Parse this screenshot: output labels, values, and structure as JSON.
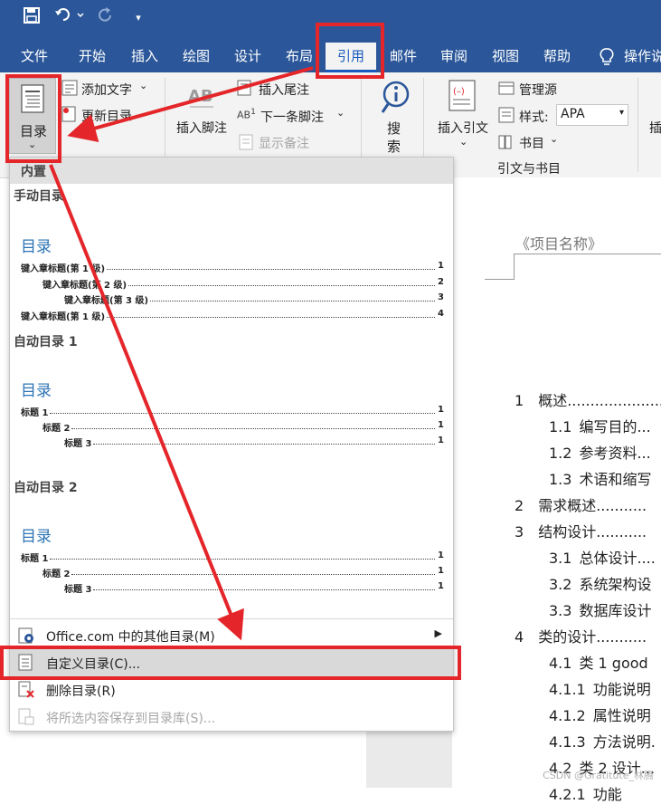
{
  "qat": {
    "save_icon": "save-icon",
    "undo_icon": "undo-icon",
    "redo_icon": "redo-icon",
    "customize_icon": "customize-icon"
  },
  "tabs": [
    "文件",
    "开始",
    "插入",
    "绘图",
    "设计",
    "布局",
    "引用",
    "邮件",
    "审阅",
    "视图",
    "帮助"
  ],
  "tell_me": "操作说",
  "ribbon": {
    "toc_button": "目录",
    "add_text": "添加文字",
    "update_toc": "更新目录",
    "insert_footnote": "插入脚注",
    "insert_endnote": "插入尾注",
    "next_footnote": "下一条脚注",
    "show_notes": "显示备注",
    "search_1": "搜",
    "search_2": "索",
    "insert_citation": "插入引文",
    "manage_sources": "管理源",
    "style_label": "样式:",
    "style_value": "APA",
    "bibliography": "书目",
    "group_citations": "引文与书目",
    "cut_label": "插"
  },
  "menu": {
    "section_builtin": "内置",
    "manual_title": "手动目录",
    "auto1_title": "自动目录 1",
    "auto2_title": "自动目录 2",
    "toc_heading": "目录",
    "manual_lines": [
      {
        "text": "键入章标题(第 1 级)",
        "num": "1"
      },
      {
        "text": "键入章标题(第 2 级)",
        "num": "2"
      },
      {
        "text": "键入章标题(第 3 级)",
        "num": "3"
      },
      {
        "text": "键入章标题(第 1 级)",
        "num": "4"
      }
    ],
    "auto_lines": [
      {
        "text": "标题 1",
        "num": "1"
      },
      {
        "text": "标题 2",
        "num": "1"
      },
      {
        "text": "标题 3",
        "num": "1"
      }
    ],
    "item_more": "Office.com 中的其他目录(M)",
    "item_custom": "自定义目录(C)...",
    "item_remove": "删除目录(R)",
    "item_save": "将所选内容保存到目录库(S)..."
  },
  "doc": {
    "project_name": "《项目名称》",
    "toc": [
      {
        "num": "1",
        "text": "概述......................"
      },
      {
        "num": "1.1",
        "text": "编写目的..."
      },
      {
        "num": "1.2",
        "text": "参考资料..."
      },
      {
        "num": "1.3",
        "text": "术语和缩写"
      },
      {
        "num": "2",
        "text": "需求概述..........."
      },
      {
        "num": "3",
        "text": "结构设计..........."
      },
      {
        "num": "3.1",
        "text": "总体设计...."
      },
      {
        "num": "3.2",
        "text": "系统架构设"
      },
      {
        "num": "3.3",
        "text": "数据库设计"
      },
      {
        "num": "4",
        "text": "类的设计..........."
      },
      {
        "num": "4.1",
        "text": "类 1    good"
      },
      {
        "num": "4.1.1",
        "text": "功能说明"
      },
      {
        "num": "4.1.2",
        "text": "属性说明"
      },
      {
        "num": "4.1.3",
        "text": "方法说明."
      },
      {
        "num": "4.2",
        "text": "类 2 设计..."
      },
      {
        "num": "4.2.1",
        "text": "功能"
      }
    ]
  },
  "watermark": "CSDN @Gratitute_林腾",
  "colors": {
    "accent": "#2b579a",
    "annotation_red": "#e4262a",
    "toc_blue": "#2e74b5"
  }
}
